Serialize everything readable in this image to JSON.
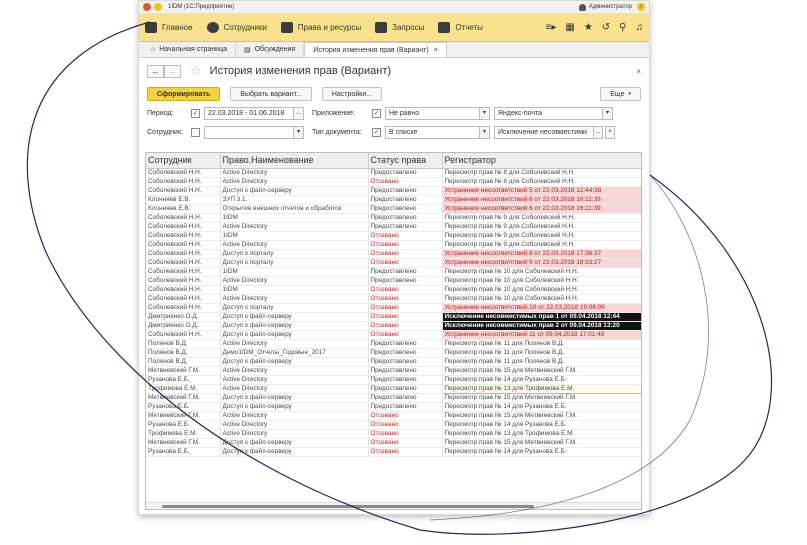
{
  "window": {
    "title": "1IDM  (1С:Предприятие)",
    "user": "Администратор"
  },
  "menu": {
    "items": [
      "Главное",
      "Сотрудники",
      "Права и ресурсы",
      "Запросы",
      "Отчеты"
    ]
  },
  "tabs": [
    {
      "label": "Начальная страница"
    },
    {
      "label": "Обсуждения"
    },
    {
      "label": "История изменения прав (Вариант)"
    }
  ],
  "page": {
    "title": "История изменения прав (Вариант)",
    "back": "←",
    "forward": "→",
    "close": "×"
  },
  "toolbar": {
    "generate": "Сформировать",
    "choose_variant": "Выбрать вариант...",
    "settings": "Настройки...",
    "more": "Еще"
  },
  "filters": {
    "period_label": "Период:",
    "period_value": "22.03.2018 - 01.06.2018",
    "period_btn": "...",
    "app_label": "Приложение:",
    "app_cond": "Не равно",
    "app_value": "Яндекс-почта",
    "employee_label": "Сотрудник:",
    "doc_label": "Тип документа:",
    "doc_cond": "В списке",
    "doc_value": "Исключение несовместими",
    "doc_btn": "...",
    "clear": "×"
  },
  "table": {
    "columns": [
      "Сотрудник",
      "Право.Наименование",
      "Статус права",
      "Регистратор"
    ],
    "rows": [
      [
        "Соболевский Н.Н.",
        "Active Directory",
        "Предоставлено",
        "Пересмотр прав № 8 для Соболевский Н.Н.",
        ""
      ],
      [
        "Соболевский Н.Н.",
        "Active Directory",
        "Отозвано",
        "Пересмотр прав № 8 для Соболевский Н.Н.",
        ""
      ],
      [
        "Соболевский Н.Н.",
        "Доступ к файл-серверу",
        "Предоставлено",
        "Устранение несоответствий 5 от 22.03.2018 12:44:38",
        "pink"
      ],
      [
        "Клонняев Е.В.",
        "ЗУП 3.1.",
        "Предоставлено",
        "Устранение несоответствий 6 от 22.03.2018 16:11:39",
        "pink"
      ],
      [
        "Клонняев Е.В.",
        "Открытие внешних отчетов и обработок",
        "Предоставлено",
        "Устранение несоответствий 6 от 22.03.2018 16:11:39",
        "pink"
      ],
      [
        "Соболевский Н.Н.",
        "1IDM",
        "Предоставлено",
        "Пересмотр прав № 9 для Соболевский Н.Н.",
        ""
      ],
      [
        "Соболевский Н.Н.",
        "Active Directory",
        "Предоставлено",
        "Пересмотр прав № 9 для Соболевский Н.Н.",
        ""
      ],
      [
        "Соболевский Н.Н.",
        "1IDM",
        "Отозвано",
        "Пересмотр прав № 9 для Соболевский Н.Н.",
        ""
      ],
      [
        "Соболевский Н.Н.",
        "Active Directory",
        "Отозвано",
        "Пересмотр прав № 9 для Соболевский Н.Н.",
        ""
      ],
      [
        "Соболевский Н.Н.",
        "Доступ к порталу",
        "Отозвано",
        "Устранение несоответствий 8 от 22.03.2018 17:36:37",
        "pink"
      ],
      [
        "Соболевский Н.Н.",
        "Доступ к порталу",
        "Отозвано",
        "Устранение несоответствий 9 от 22.03.2018 18:33:27",
        "pink"
      ],
      [
        "Соболевский Н.Н.",
        "1IDM",
        "Предоставлено",
        "Пересмотр прав № 10 для Соболевский Н.Н.",
        ""
      ],
      [
        "Соболевский Н.Н.",
        "Active Directory",
        "Предоставлено",
        "Пересмотр прав № 10 для Соболевский Н.Н.",
        ""
      ],
      [
        "Соболевский Н.Н.",
        "1IDM",
        "Отозвано",
        "Пересмотр прав № 10 для Соболевский Н.Н.",
        ""
      ],
      [
        "Соболевский Н.Н.",
        "Active Directory",
        "Отозвано",
        "Пересмотр прав № 10 для Соболевский Н.Н.",
        ""
      ],
      [
        "Соболевский Н.Н.",
        "Доступ к порталу",
        "Отозвано",
        "Устранение несоответствий 10 от 22.03.2018 19:06:09",
        "pink"
      ],
      [
        "Дмитриенко О.Д.",
        "Доступ к файл-серверу",
        "Отозвано",
        "Исключение несовместимых прав 1 от 09.04.2018 12:44",
        "black"
      ],
      [
        "Дмитриенко О.Д.",
        "Доступ к файл-серверу",
        "Отозвано",
        "Исключение несовместимых прав 2 от 09.04.2018 13:20",
        "black"
      ],
      [
        "Соболевский Н.Н.",
        "Доступ к файл-серверу",
        "Отозвано",
        "Устранение несоответствий 11 от 09.04.2018 17:01:49",
        "pink"
      ],
      [
        "Полянов В.Д.",
        "Active Directory",
        "Предоставлено",
        "Пересмотр прав № 11 для Полянов В.Д.",
        ""
      ],
      [
        "Полянов В.Д.",
        "Демо1IDM_Отчеты_Годовые_2017",
        "Предоставлено",
        "Пересмотр прав № 11 для Полянов В.Д.",
        ""
      ],
      [
        "Полянов В.Д.",
        "Доступ к файл-серверу",
        "Предоставлено",
        "Пересмотр прав № 11 для Полянов В.Д.",
        ""
      ],
      [
        "Метвиевский Г.М.",
        "Active Directory",
        "Предоставлено",
        "Пересмотр прав № 15 для Метвиевский Г.М.",
        ""
      ],
      [
        "Рузанова Е.Б.",
        "Active Directory",
        "Предоставлено",
        "Пересмотр прав № 14 для Рузанова Е.Б.",
        ""
      ],
      [
        "Трофимова Е.М.",
        "Active Directory",
        "Предоставлено",
        "Пересмотр прав № 13 для Трофимова Е.М.",
        "sel"
      ],
      [
        "Метвиевский Г.М.",
        "Доступ к файл-серверу",
        "Предоставлено",
        "Пересмотр прав № 15 для Метвиевский Г.М.",
        ""
      ],
      [
        "Рузанова Е.Б.",
        "Доступ к файл-серверу",
        "Предоставлено",
        "Пересмотр прав № 14 для Рузанова Е.Б.",
        ""
      ],
      [
        "Метвиевский Г.М.",
        "Active Directory",
        "Отозвано",
        "Пересмотр прав № 15 для Метвиевский Г.М.",
        ""
      ],
      [
        "Рузанова Е.Б.",
        "Active Directory",
        "Отозвано",
        "Пересмотр прав № 14 для Рузанова Е.Б.",
        ""
      ],
      [
        "Трофимова Е.М.",
        "Active Directory",
        "Отозвано",
        "Пересмотр прав № 13 для Трофимова Е.М.",
        ""
      ],
      [
        "Метвиевский Г.М.",
        "Доступ к файл-серверу",
        "Отозвано",
        "Пересмотр прав № 15 для Метвиевский Г.М.",
        ""
      ],
      [
        "Рузанова Е.Б.",
        "Доступ к файл-серверу",
        "Отозвано",
        "Пересмотр прав № 14 для Рузанова Е.Б.",
        ""
      ]
    ]
  },
  "colors": {
    "menu_bg": "#f9e28e",
    "revoked": "#d81c1c",
    "highlight_pink": "#f8d6d6",
    "primary_button": "#f5d13b",
    "ellipse_stroke": "#1e2a5a"
  }
}
